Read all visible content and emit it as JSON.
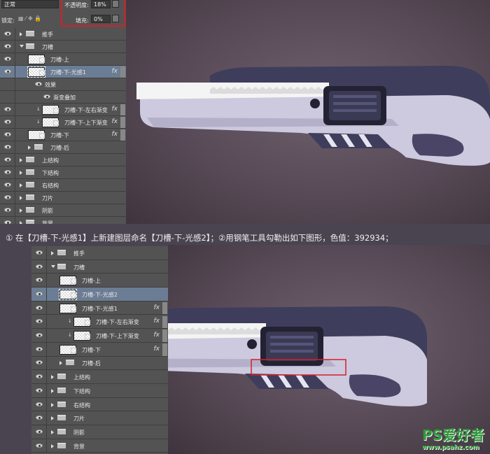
{
  "top": {
    "blend_mode": "正常",
    "opacity_label": "不透明度:",
    "opacity_value": "18%",
    "lock_label": "锁定:",
    "fill_label": "填充:",
    "fill_value": "0%",
    "layers": [
      {
        "label": "推手",
        "type": "group",
        "indent": 0
      },
      {
        "label": "刀槽",
        "type": "group-open",
        "indent": 0
      },
      {
        "label": "刀槽-上",
        "type": "layer",
        "indent": 1
      },
      {
        "label": "刀槽-下-光感1",
        "type": "layer",
        "indent": 1,
        "selected": true,
        "fx": true
      },
      {
        "label": "效果",
        "type": "effect",
        "indent": 2
      },
      {
        "label": "渐变叠加",
        "type": "effect",
        "indent": 3
      },
      {
        "label": "刀槽-下-左右渐变",
        "type": "layer",
        "indent": 2,
        "clip": true,
        "fx": true
      },
      {
        "label": "刀槽-下-上下渐变",
        "type": "layer",
        "indent": 2,
        "clip": true,
        "fx": true
      },
      {
        "label": "刀槽-下",
        "type": "layer",
        "indent": 1,
        "fx": true
      },
      {
        "label": "刀槽-后",
        "type": "group",
        "indent": 1
      },
      {
        "label": "上结构",
        "type": "group",
        "indent": 0
      },
      {
        "label": "下结构",
        "type": "group",
        "indent": 0
      },
      {
        "label": "右结构",
        "type": "group",
        "indent": 0
      },
      {
        "label": "刀片",
        "type": "group",
        "indent": 0
      },
      {
        "label": "阴影",
        "type": "group",
        "indent": 0
      },
      {
        "label": "背景",
        "type": "group",
        "indent": 0
      }
    ]
  },
  "caption": "① 在【刀槽-下-光感1】上新建图层命名【刀槽-下-光感2】；②用钢笔工具勾勒出如下图形，色值：392934；",
  "bottom": {
    "layers": [
      {
        "label": "推手",
        "type": "group",
        "indent": 0
      },
      {
        "label": "刀槽",
        "type": "group-open",
        "indent": 0
      },
      {
        "label": "刀槽-上",
        "type": "layer",
        "indent": 1
      },
      {
        "label": "刀槽-下-光感2",
        "type": "layer",
        "indent": 1,
        "selected": true
      },
      {
        "label": "刀槽-下-光感1",
        "type": "layer",
        "indent": 1,
        "fx": true
      },
      {
        "label": "刀槽-下-左右渐变",
        "type": "layer",
        "indent": 2,
        "clip": true,
        "fx": true
      },
      {
        "label": "刀槽-下-上下渐变",
        "type": "layer",
        "indent": 2,
        "clip": true,
        "fx": true
      },
      {
        "label": "刀槽-下",
        "type": "layer",
        "indent": 1,
        "fx": true
      },
      {
        "label": "刀槽-后",
        "type": "group",
        "indent": 1
      },
      {
        "label": "上结构",
        "type": "group",
        "indent": 0
      },
      {
        "label": "下结构",
        "type": "group",
        "indent": 0
      },
      {
        "label": "右结构",
        "type": "group",
        "indent": 0
      },
      {
        "label": "刀片",
        "type": "group",
        "indent": 0
      },
      {
        "label": "阴影",
        "type": "group",
        "indent": 0
      },
      {
        "label": "背景",
        "type": "group",
        "indent": 0
      }
    ]
  },
  "watermark": {
    "logo": "PS爱好者",
    "url": "www.psahz.com"
  },
  "colors": {
    "highlight_red": "#d3202a",
    "selected_row": "#6b7d94",
    "panel": "#535353",
    "knife_dark": "#3f3d5c",
    "knife_light": "#c9c5dc",
    "shape_color": "#392934"
  }
}
